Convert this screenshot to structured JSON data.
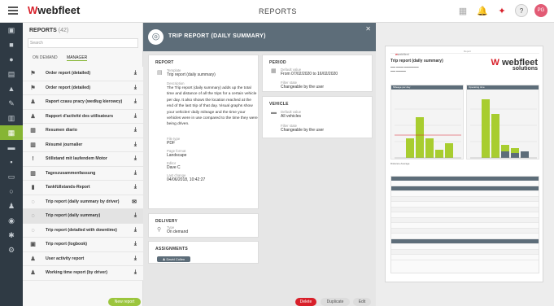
{
  "topbar": {
    "logo_prefix": "webfleet",
    "page_title": "REPORTS",
    "user_initials": "PG",
    "notification_badge": "3"
  },
  "sidebar_nav": [
    "dashboard-icon",
    "vehicles-icon",
    "drivers-icon",
    "map-icon",
    "alerts-icon",
    "tools-icon",
    "charts-icon",
    "reports-icon",
    "orders-icon",
    "trucks-icon",
    "cards-icon",
    "clock-icon",
    "people-icon",
    "signal-icon",
    "settings-icon",
    "gear-icon"
  ],
  "reports_panel": {
    "title": "REPORTS",
    "count": "(42)",
    "search_placeholder": "Search",
    "tabs": [
      "ON DEMAND",
      "MANAGER"
    ],
    "active_tab": "MANAGER",
    "new_report_label": "New report",
    "items": [
      {
        "label": "Order report (detailed)",
        "icon": "user-route-icon"
      },
      {
        "label": "Order report (detailed)",
        "icon": "user-route-icon"
      },
      {
        "label": "Raport czasu pracy (według kierowcy)",
        "icon": "driver-icon"
      },
      {
        "label": "Rapport d'activité des utilisateurs",
        "icon": "driver-icon"
      },
      {
        "label": "Resumen diario",
        "icon": "chart-icon"
      },
      {
        "label": "Résumé journalier",
        "icon": "chart-icon"
      },
      {
        "label": "Stillstand mit laufendem Motor",
        "icon": "alert-icon"
      },
      {
        "label": "Tageszusammenfassung",
        "icon": "chart-icon"
      },
      {
        "label": "Tankfüllstands-Report",
        "icon": "fuel-icon"
      },
      {
        "label": "Trip report (daily summary by driver)",
        "icon": "route-icon"
      },
      {
        "label": "Trip report (daily summary)",
        "icon": "route-icon"
      },
      {
        "label": "Trip report (detailed with downtime)",
        "icon": "route-icon"
      },
      {
        "label": "Trip report (logbook)",
        "icon": "logbook-icon"
      },
      {
        "label": "User activity report",
        "icon": "driver-icon"
      },
      {
        "label": "Working time report (by driver)",
        "icon": "driver-icon"
      }
    ]
  },
  "detail": {
    "header_title": "TRIP REPORT (DAILY SUMMARY)",
    "report_section": {
      "heading": "REPORT",
      "template_label": "Template",
      "template_value": "Trip report (daily summary)",
      "description_label": "Description",
      "description_value": "The Trip report (daily summary) adds up the total time and distance of all the trips for a certain vehicle per day. It also shows the location reached at the end of the last trip of that day. Visual graphs show your vehicles' daily mileage and the time your vehicles were in use compared to the time they were being driven.",
      "filetype_label": "File type",
      "filetype_value": "PDF",
      "format_label": "Page format",
      "format_value": "Landscape",
      "editor_label": "Editor",
      "editor_value": "Dave C",
      "lastchange_label": "Last change",
      "lastchange_value": "04/06/2018, 10:42:27"
    },
    "period_section": {
      "heading": "PERIOD",
      "default_label": "Default value",
      "default_value": "From 07/02/2020 to 16/02/2020",
      "filter_label": "Filter state",
      "filter_value": "Changeable by the user"
    },
    "vehicle_section": {
      "heading": "VEHICLE",
      "default_label": "Default value",
      "default_value": "All vehicles",
      "filter_label": "Filter state",
      "filter_value": "Changeable by the user"
    },
    "delivery_section": {
      "heading": "DELIVERY",
      "type_label": "Type",
      "type_value": "On demand"
    },
    "assignments_section": {
      "heading": "ASSIGNMENTS",
      "assignee": "David Collen"
    },
    "actions": {
      "delete": "Delete",
      "duplicate": "Duplicate",
      "edit": "Edit"
    }
  },
  "preview": {
    "logo_small": "webfleet",
    "header_right": "Report",
    "title": "Trip report (daily summary)",
    "brand_main": "webfleet",
    "brand_sub": "solutions",
    "chart_left_title": "Mileage per day",
    "chart_right_title": "Operating time",
    "legend": "Distance   Average",
    "colors": {
      "bar": "#a8cd2f",
      "dark": "#5d6d79",
      "accent": "#d8202a"
    }
  }
}
